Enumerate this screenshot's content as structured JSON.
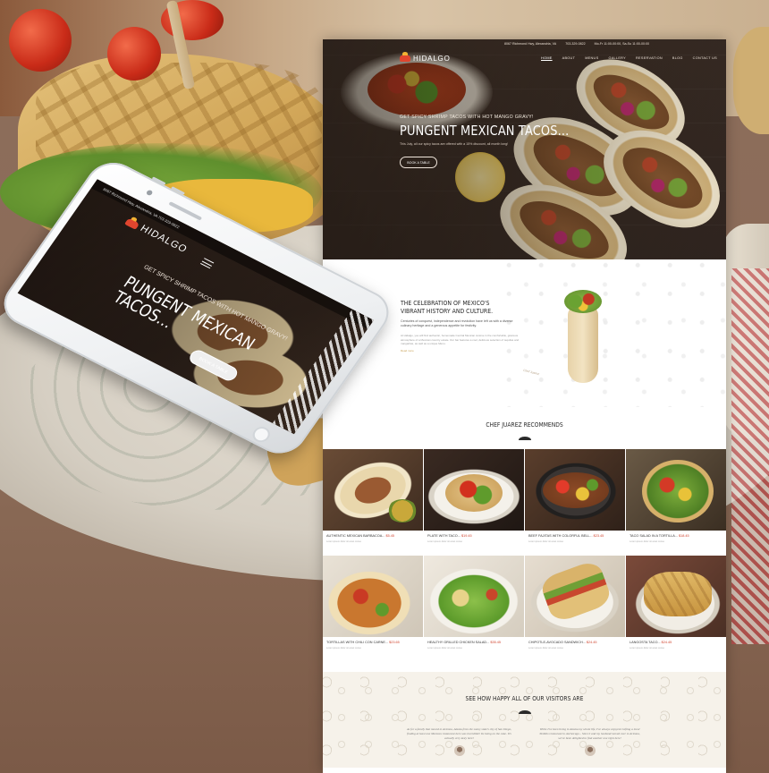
{
  "site": {
    "brand": "HIDALGO",
    "topbar": {
      "address": "8067 Richmond Hwy, Alexandria, VA",
      "phone": "703-329-0822",
      "hours": "Mo-Fr 11:00-00:00, Sa-Su 11:00-00:00"
    },
    "nav": [
      "HOME",
      "ABOUT",
      "MENUS",
      "GALLERY",
      "RESERVATION",
      "BLOG",
      "CONTACT US"
    ],
    "hero": {
      "kicker": "GET SPICY SHRIMP TACOS WITH HOT MANGO GRAVY!",
      "title": "PUNGENT MEXICAN TACOS...",
      "subtitle": "This July, all our spicy tacos are offered with a 15% discount, all month long!",
      "button": "BOOK A TABLE"
    },
    "about": {
      "title_line1": "THE CELEBRATION OF MEXICO'S",
      "title_line2": "VIBRANT HISTORY AND CULTURE.",
      "intro": "Centuries of conquest, independence and revolution have left us with a diverse culinary heritage and a generous appetite for festivity.",
      "body": "At Hidalgo, you will find authentic, homemade Central Mexican cuisine in the comfortable, gracious atmosphere of a Mexican country estate. Our bar features a cool, delicious selection of tequilas and margaritas, as well as a unique Menu.",
      "link": "Read more",
      "signature": "Chef Juarez"
    },
    "chef": {
      "title": "CHEF JUAREZ RECOMMENDS"
    },
    "menu_items": [
      {
        "name": "AUTHENTIC MEXICAN BARBACOA...",
        "price": "$5.45",
        "desc": "Lorem ipsum dolor sit amet conse"
      },
      {
        "name": "PLATE WITH TACO...",
        "price": "$19.45",
        "desc": "Lorem ipsum dolor sit amet conse"
      },
      {
        "name": "BEEF FAJITAS WITH COLORFUL BELL...",
        "price": "$23.45",
        "desc": "Lorem ipsum dolor sit amet conse"
      },
      {
        "name": "TACO SALAD IN A TORTILLA...",
        "price": "$18.45",
        "desc": "Lorem ipsum dolor sit amet conse"
      },
      {
        "name": "TORTILLAS WITH CHILI CON CARNE...",
        "price": "$23.65",
        "desc": "Lorem ipsum dolor sit amet conse"
      },
      {
        "name": "HEALTHY GRILLED CHICKEN SALAD...",
        "price": "$35.45",
        "desc": "Lorem ipsum dolor sit amet conse"
      },
      {
        "name": "CHIPOTLE-AVOCADO SANDWICH...",
        "price": "$24.45",
        "desc": "Lorem ipsum dolor sit amet conse"
      },
      {
        "name": "LANGOSTA TACO...",
        "price": "$24.45",
        "desc": "Lorem ipsum dolor sit amet conse"
      }
    ],
    "testimonials": {
      "title": "SEE HOW HAPPY ALL OF OUR VISITORS ARE",
      "quotes": [
        "As for a family that moved to Arizona, Alaska from the sunny state's city of San Diego, finding at least one Mexican restaurant here was incredible! Its being on the cake. It's actually very tasty here!",
        "While I've been living in Alaska my whole life, I've always enjoyed crafting a local TexMex restaurant in Anchorage... Since I and my husband moved over to Arizona, we've been delighted to find another one right here!"
      ]
    }
  },
  "phone": {
    "topbar": "8067 Richmond Hwy, Alexandria, VA   703-329-0822",
    "brand": "HIDALGO",
    "kicker": "GET SPICY SHRIMP TACOS WITH HOT MANGO GRAVY!",
    "title": "PUNGENT MEXICAN TACOS...",
    "button": "BOOK A TABLE"
  },
  "colors": {
    "accent": "#d0442f",
    "brand_red": "#e0452e",
    "brand_gold": "#f2b234"
  }
}
